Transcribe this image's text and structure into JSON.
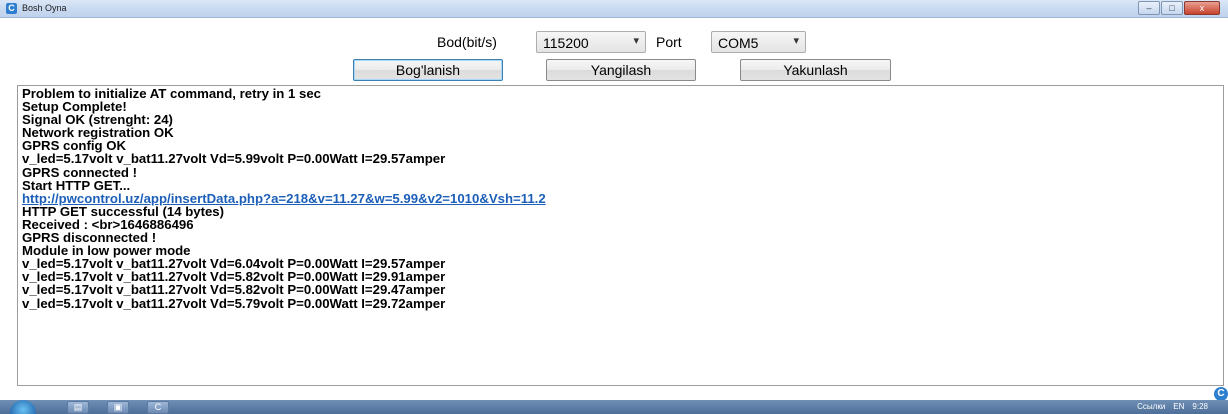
{
  "window": {
    "title": "Bosh Oyna",
    "controls": {
      "minimize": "–",
      "maximize": "□",
      "close": "x"
    }
  },
  "settings": {
    "baud_label": "Bod(bit/s)",
    "baud_value": "115200",
    "port_label": "Port",
    "port_value": "COM5",
    "dropdown_arrow": "▾"
  },
  "buttons": {
    "connect": "Bog'lanish",
    "refresh": "Yangilash",
    "finish": "Yakunlash"
  },
  "log": {
    "lines": [
      {
        "text": "Problem to initialize AT command, retry in 1 sec",
        "link": false
      },
      {
        "text": "Setup Complete!",
        "link": false
      },
      {
        "text": "Signal OK (strenght: 24)",
        "link": false
      },
      {
        "text": "Network registration OK",
        "link": false
      },
      {
        "text": "GPRS config OK",
        "link": false
      },
      {
        "text": "v_led=5.17volt v_bat11.27volt Vd=5.99volt P=0.00Watt I=29.57amper",
        "link": false
      },
      {
        "text": "GPRS connected !",
        "link": false
      },
      {
        "text": "Start HTTP GET...",
        "link": false
      },
      {
        "text": "http://pwcontrol.uz/app/insertData.php?a=218&v=11.27&w=5.99&v2=1010&Vsh=11.2",
        "link": true
      },
      {
        "text": "HTTP GET successful (14 bytes)",
        "link": false
      },
      {
        "text": "Received : <br>1646886496",
        "link": false
      },
      {
        "text": "GPRS disconnected !",
        "link": false
      },
      {
        "text": "Module in low power mode",
        "link": false
      },
      {
        "text": "v_led=5.17volt v_bat11.27volt Vd=6.04volt P=0.00Watt I=29.57amper",
        "link": false
      },
      {
        "text": "v_led=5.17volt v_bat11.27volt Vd=5.82volt P=0.00Watt I=29.91amper",
        "link": false
      },
      {
        "text": "v_led=5.17volt v_bat11.27volt Vd=5.82volt P=0.00Watt I=29.47amper",
        "link": false
      },
      {
        "text": "v_led=5.17volt v_bat11.27volt Vd=5.79volt P=0.00Watt I=29.72amper",
        "link": false
      }
    ]
  },
  "taskbar": {
    "tray_text": "Ссылки",
    "language": "EN",
    "time": "9:28"
  }
}
